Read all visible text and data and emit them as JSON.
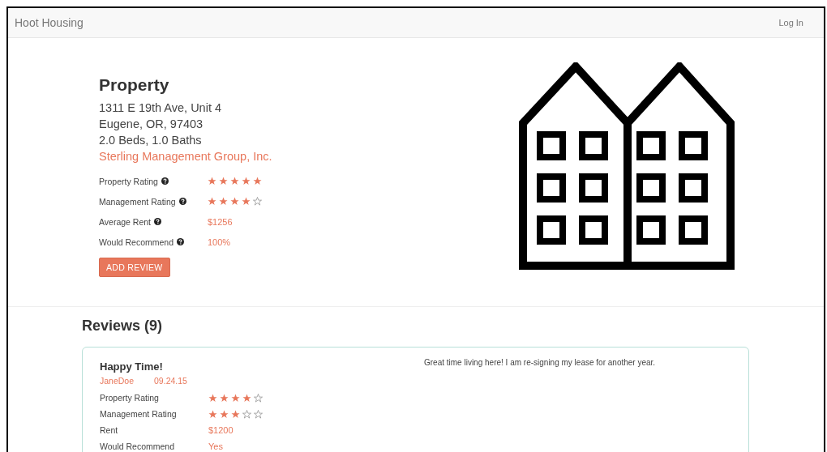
{
  "navbar": {
    "brand": "Hoot Housing",
    "login": "Log In"
  },
  "property": {
    "title": "Property",
    "address_lines": [
      "1311 E 19th Ave, Unit 4",
      "Eugene, OR, 97403",
      "2.0 Beds, 1.0 Baths"
    ],
    "manager": "Sterling Management Group, Inc.",
    "stats": [
      {
        "label": "Property Rating",
        "kind": "stars",
        "stars": 5
      },
      {
        "label": "Management Rating",
        "kind": "stars",
        "stars": 4
      },
      {
        "label": "Average Rent",
        "kind": "text",
        "value": "$1256"
      },
      {
        "label": "Would Recommend",
        "kind": "text",
        "value": "100%"
      }
    ],
    "button": "ADD REVIEW"
  },
  "reviews": {
    "heading": "Reviews (9)",
    "items": [
      {
        "title": "Happy Time!",
        "author": "JaneDoe",
        "date": "09.24.15",
        "comment": "Great time living here! I am re-signing my lease for another year.",
        "stats": [
          {
            "label": "Property Rating",
            "kind": "stars",
            "stars": 4
          },
          {
            "label": "Management Rating",
            "kind": "stars",
            "stars": 3
          },
          {
            "label": "Rent",
            "kind": "text",
            "value": "$1200"
          },
          {
            "label": "Would Recommend",
            "kind": "text",
            "value": "Yes"
          }
        ]
      }
    ]
  }
}
